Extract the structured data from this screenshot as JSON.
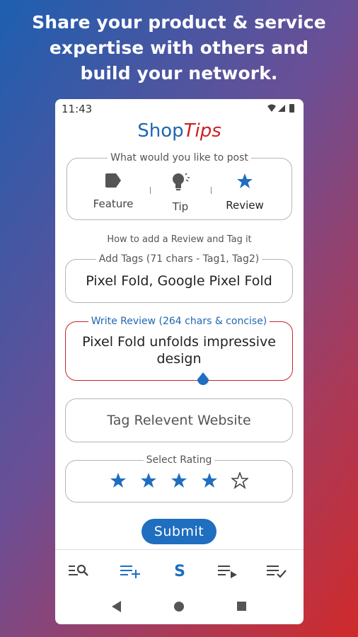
{
  "promo": {
    "headline_lines": [
      "Share your product & service",
      "expertise with others and",
      "build your network."
    ]
  },
  "status_bar": {
    "time": "11:43",
    "icons": [
      "wifi-icon",
      "signal-icon",
      "battery-icon"
    ]
  },
  "app": {
    "brand_part1": "Shop",
    "brand_part2": "Tips"
  },
  "post_type": {
    "legend": "What would you like to post",
    "options": [
      {
        "label": "Feature",
        "icon": "label-icon",
        "selected": false
      },
      {
        "label": "Tip",
        "icon": "lightbulb-icon",
        "selected": false
      },
      {
        "label": "Review",
        "icon": "star-icon",
        "selected": true
      }
    ]
  },
  "howto_link": "How to add a Review and Tag it",
  "tags_field": {
    "legend": "Add Tags (71 chars - Tag1, Tag2)",
    "value": "Pixel Fold, Google Pixel Fold"
  },
  "review_field": {
    "legend": "Write Review (264 chars & concise)",
    "value_line1": "Pixel Fold unfolds impressive",
    "value_line2": "design"
  },
  "website_field": {
    "placeholder": "Tag Relevent Website"
  },
  "rating": {
    "legend": "Select Rating",
    "value": 4,
    "max": 5
  },
  "submit_label": "Submit",
  "colors": {
    "accent": "#1f6ec0",
    "brand_red": "#cc1f1f",
    "error": "#c8232c"
  },
  "bottom_tabs": [
    {
      "icon": "search-list-icon",
      "active": false
    },
    {
      "icon": "add-list-icon",
      "active": true
    },
    {
      "icon": "shoptips-s-icon",
      "active": true
    },
    {
      "icon": "play-list-icon",
      "active": false
    },
    {
      "icon": "checklist-icon",
      "active": false
    }
  ],
  "nav_buttons": [
    "back-icon",
    "home-icon",
    "recents-icon"
  ]
}
